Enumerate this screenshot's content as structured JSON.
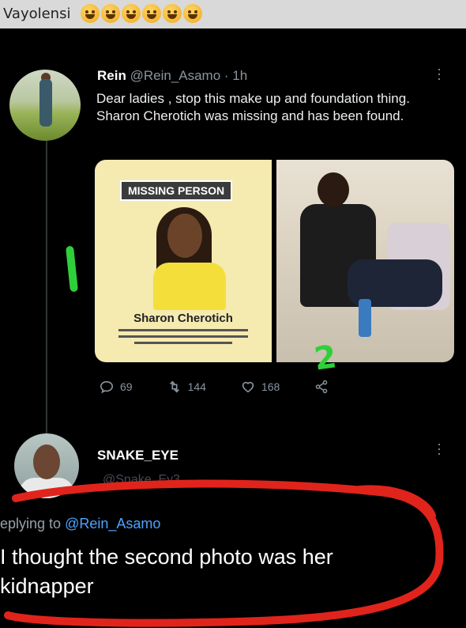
{
  "post": {
    "poster_name": "Vayolensi",
    "emoji_count": 6,
    "emoji_icon": "grinning-face-icon"
  },
  "tweet": {
    "name": "Rein",
    "handle": "@Rein_Asamo",
    "time": "· 1h",
    "text": "Dear ladies , stop this make up and foundation thing. Sharon Cherotich was missing and has been found.",
    "media": {
      "tag": "MISSING PERSON",
      "caption": "Sharon Cherotich"
    },
    "annotations": [
      "1",
      "2"
    ],
    "stats": {
      "replies": "69",
      "retweets": "144",
      "likes": "168"
    }
  },
  "reply": {
    "name": "SNAKE_EYE",
    "handle": "@Snake_Ey3",
    "replying_prefix": "eplying to ",
    "replying_handle": "@Rein_Asamo",
    "text": "I thought the second photo was her kidnapper"
  },
  "colors": {
    "background": "#000000",
    "link": "#4da3ff",
    "annotation_green": "#2fcf3a",
    "circle_red": "#e0241c"
  }
}
